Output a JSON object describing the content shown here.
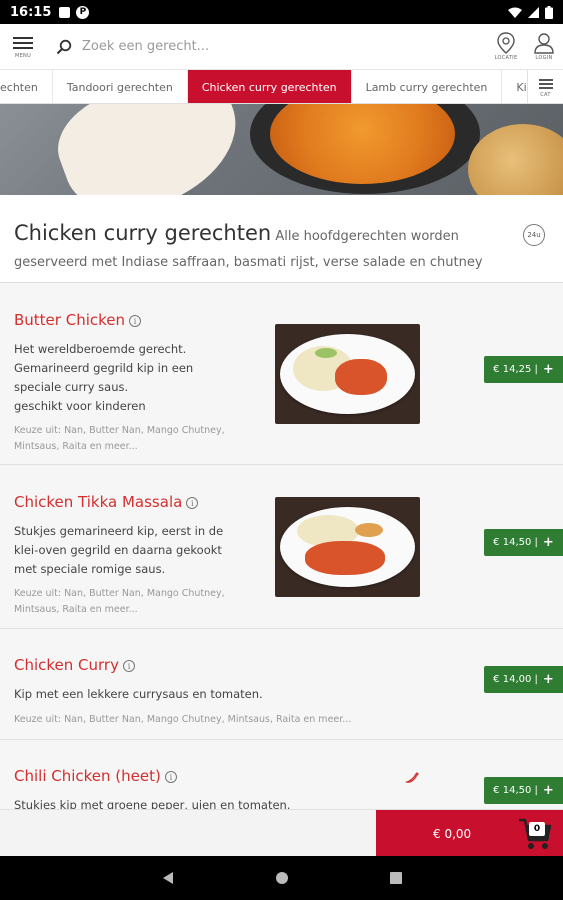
{
  "status_bar": {
    "time": "16:15"
  },
  "topbar": {
    "menu_label": "MENU",
    "search_placeholder": "Zoek een gerecht...",
    "location_label": "LOCATIE",
    "login_label": "LOGIN"
  },
  "tabs": [
    {
      "label": "echten"
    },
    {
      "label": "Tandoori gerechten"
    },
    {
      "label": "Chicken curry gerechten",
      "active": true
    },
    {
      "label": "Lamb curry gerechten"
    },
    {
      "label": "King"
    }
  ],
  "tabs_cat_label": "CAT",
  "category": {
    "title": "Chicken curry gerechten",
    "description": " Alle hoofdgerechten worden geserveerd met Indiase saffraan, basmati rijst, verse salade en chutney",
    "badge": "24u"
  },
  "items": [
    {
      "name": "Butter Chicken",
      "description": [
        "Het wereldberoemde gerecht.",
        "Gemarineerd gegrild kip in een",
        "speciale curry saus.",
        "geschikt voor kinderen"
      ],
      "choices": [
        "Keuze uit: Nan, Butter Nan, Mango Chutney,",
        "Mintsaus, Raita en meer..."
      ],
      "price": "€ 14,25"
    },
    {
      "name": "Chicken Tikka Massala",
      "description": [
        "Stukjes gemarineerd kip, eerst in de",
        "klei-oven gegrild en daarna gekookt",
        "met speciale romige saus."
      ],
      "choices": [
        "Keuze uit: Nan, Butter Nan, Mango Chutney,",
        "Mintsaus, Raita en meer..."
      ],
      "price": "€ 14,50"
    },
    {
      "name": "Chicken Curry",
      "description": [
        "Kip met een lekkere currysaus en tomaten."
      ],
      "choices": [
        "Keuze uit: Nan, Butter Nan, Mango Chutney, Mintsaus, Raita en meer..."
      ],
      "price": "€ 14,00"
    },
    {
      "name": "Chili Chicken (heet)",
      "description": [
        "Stukjes kip met groene peper, uien en tomaten."
      ],
      "choices": [],
      "price": "€ 14,50"
    }
  ],
  "price_separator": "|",
  "price_plus": "+",
  "info_glyph": "i",
  "cart": {
    "total": "€ 0,00",
    "count": "0"
  },
  "colors": {
    "brand_red": "#c8102e",
    "price_green": "#2e7d32"
  }
}
